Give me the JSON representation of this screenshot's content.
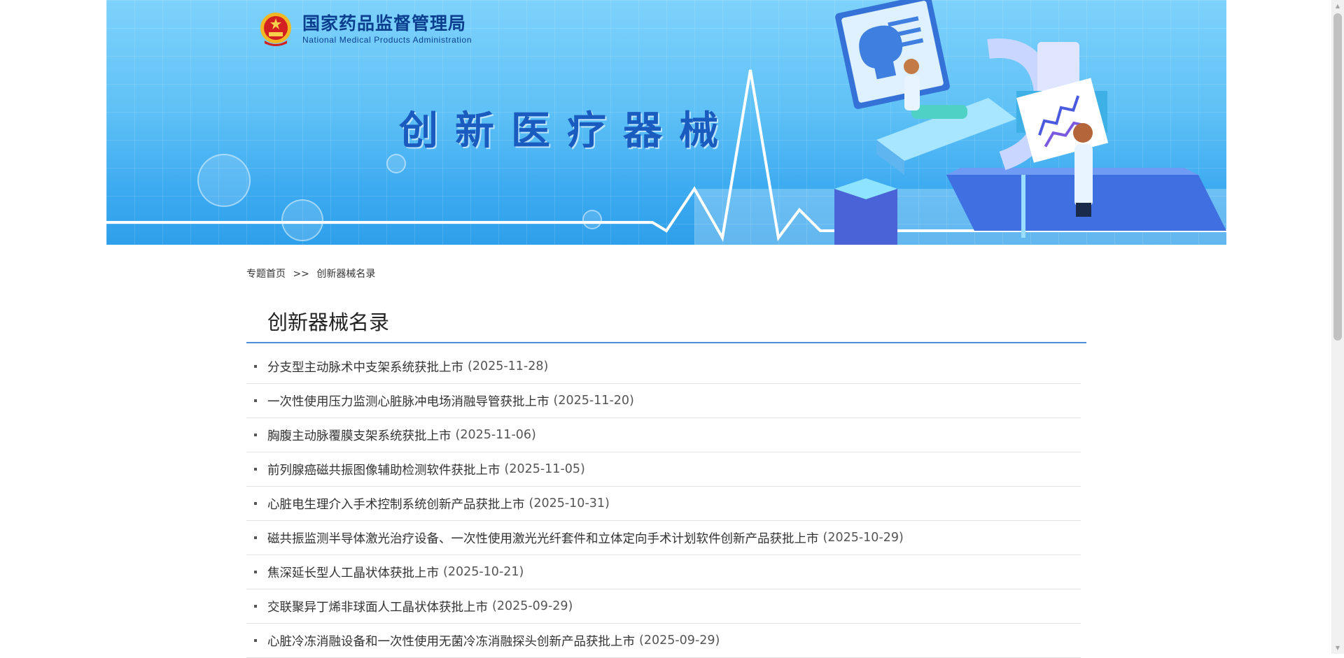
{
  "header": {
    "org_name_cn": "国家药品监督管理局",
    "org_name_en": "National Medical Products Administration",
    "banner_title": "创新医疗器械",
    "colors": {
      "banner_sky": "#5fc1f6",
      "title_blue": "#1a5bbf",
      "org_navy": "#0b3e8f"
    }
  },
  "breadcrumb": {
    "home": "专题首页",
    "separator": ">>",
    "current": "创新器械名录"
  },
  "section": {
    "title": "创新器械名录",
    "accent_color": "#4a90d9"
  },
  "items": [
    {
      "title": "分支型主动脉术中支架系统获批上市",
      "date": "(2025-11-28)"
    },
    {
      "title": "一次性使用压力监测心脏脉冲电场消融导管获批上市",
      "date": "(2025-11-20)"
    },
    {
      "title": "胸腹主动脉覆膜支架系统获批上市",
      "date": "(2025-11-06)"
    },
    {
      "title": "前列腺癌磁共振图像辅助检测软件获批上市",
      "date": "(2025-11-05)"
    },
    {
      "title": "心脏电生理介入手术控制系统创新产品获批上市",
      "date": "(2025-10-31)"
    },
    {
      "title": "磁共振监测半导体激光治疗设备、一次性使用激光光纤套件和立体定向手术计划软件创新产品获批上市",
      "date": "(2025-10-29)"
    },
    {
      "title": "焦深延长型人工晶状体获批上市",
      "date": "(2025-10-21)"
    },
    {
      "title": "交联聚异丁烯非球面人工晶状体获批上市",
      "date": "(2025-09-29)"
    },
    {
      "title": "心脏冷冻消融设备和一次性使用无菌冷冻消融探头创新产品获批上市",
      "date": "(2025-09-29)"
    }
  ],
  "icons": {
    "emblem": "national-emblem-icon",
    "bullet": "square-bullet-icon",
    "scroll_up": "scroll-up-arrow-icon",
    "scroll_down": "scroll-down-arrow-icon"
  }
}
